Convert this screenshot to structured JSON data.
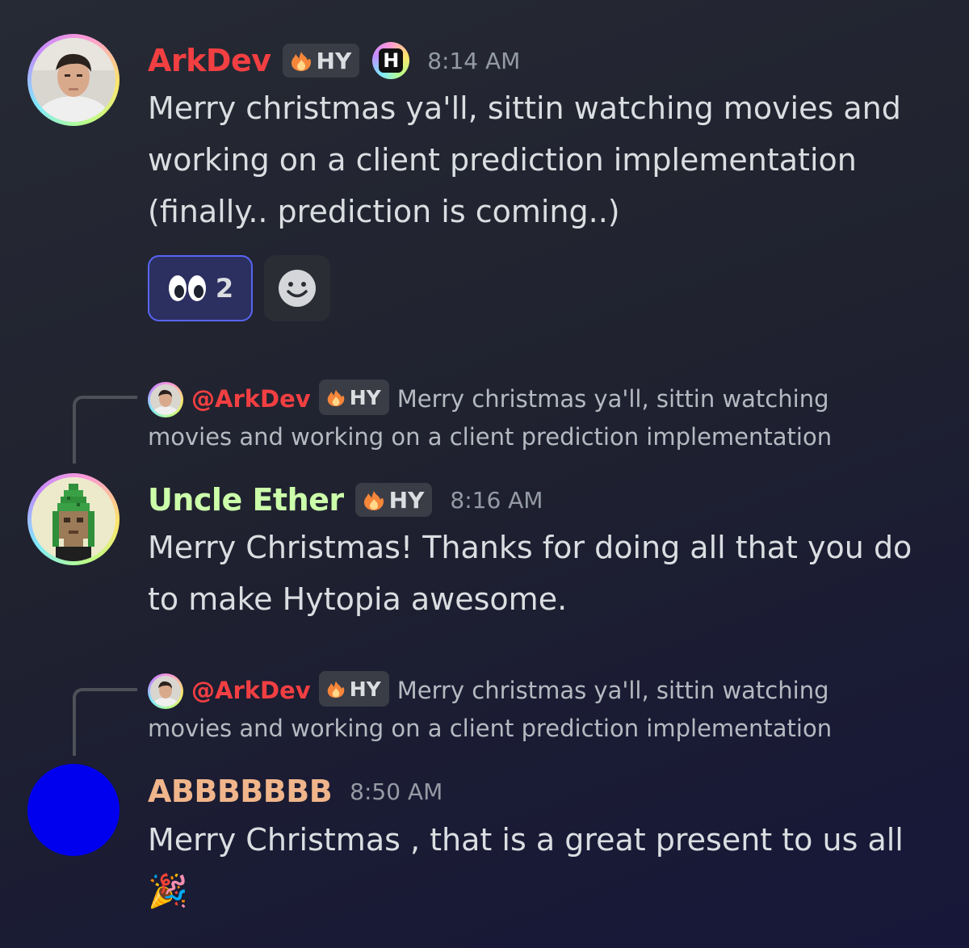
{
  "messages": [
    {
      "username": "ArkDev",
      "username_color": "#f23f42",
      "tag": "HY",
      "server_badge": "H",
      "timestamp": "8:14 AM",
      "lines": [
        "Merry christmas ya'll, sittin watching movies and",
        "working on a client prediction implementation",
        "(finally.. prediction is coming..)"
      ],
      "reactions": [
        {
          "emoji": "👀",
          "icon": "eyes-icon",
          "count": "2",
          "active": true
        }
      ],
      "add_reaction_icon": "add-reaction-icon"
    },
    {
      "reply_to": {
        "mention": "@ArkDev",
        "tag": "HY",
        "preview_line1": "Merry christmas ya'll, sittin watching",
        "preview_line2": "movies and working on a client prediction implementation"
      },
      "username": "Uncle Ether",
      "username_color": "#ccffaa",
      "tag": "HY",
      "timestamp": "8:16 AM",
      "lines": [
        "Merry Christmas! Thanks for doing all that you do",
        "to make Hytopia awesome."
      ]
    },
    {
      "reply_to": {
        "mention": "@ArkDev",
        "tag": "HY",
        "preview_line1": "Merry christmas ya'll, sittin watching",
        "preview_line2": "movies and working on a client prediction implementation"
      },
      "username": "ABBBBBBB",
      "username_color": "#f0b58a",
      "timestamp": "8:50 AM",
      "lines": [
        "Merry Christmas , that is a great present to us all",
        "🎉"
      ]
    }
  ]
}
